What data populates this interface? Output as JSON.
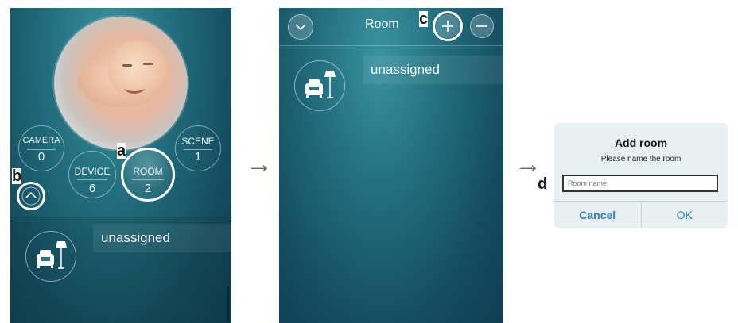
{
  "screen1": {
    "camera": {
      "label": "CAMERA",
      "count": "0"
    },
    "scene": {
      "label": "SCENE",
      "count": "1"
    },
    "device": {
      "label": "DEVICE",
      "count": "6"
    },
    "room": {
      "label": "ROOM",
      "count": "2"
    },
    "room_item": "unassigned"
  },
  "screen2": {
    "header_title": "Room",
    "room_item": "unassigned"
  },
  "dialog": {
    "title": "Add room",
    "message": "Please name the room",
    "input_placeholder": "Room name",
    "cancel_label": "Cancel",
    "ok_label": "OK"
  },
  "markers": {
    "a": "a",
    "b": "b",
    "c": "c",
    "d": "d"
  },
  "arrows": {
    "first": "→",
    "second": "→"
  },
  "colors": {
    "highlight": "#ffffff",
    "accent": "#2a7fc4",
    "screen_bg": "#1f6576"
  }
}
